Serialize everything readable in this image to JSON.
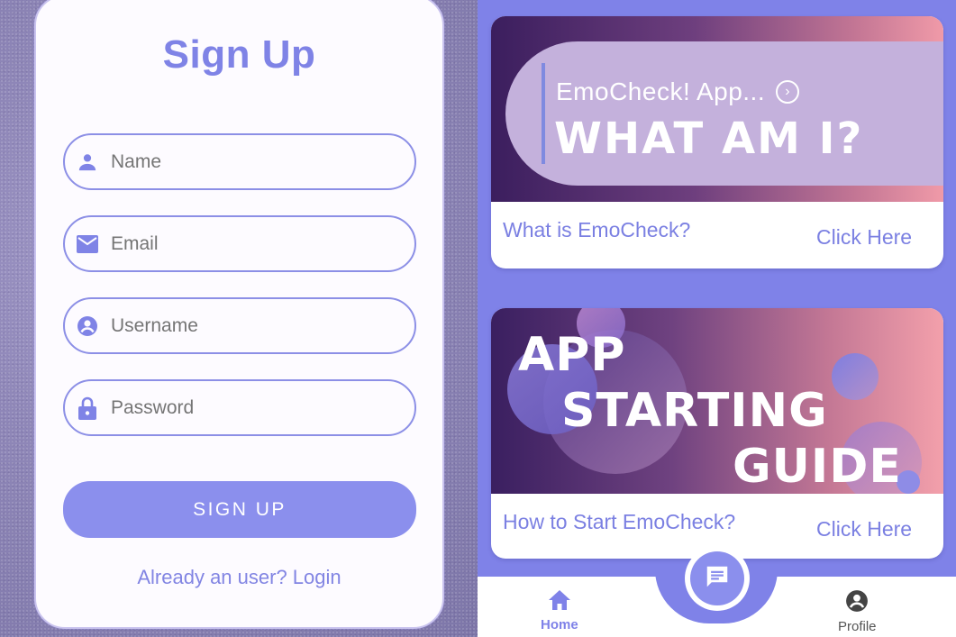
{
  "signup": {
    "title": "Sign Up",
    "fields": [
      {
        "placeholder": "Name",
        "icon": "person-icon"
      },
      {
        "placeholder": "Email",
        "icon": "mail-icon"
      },
      {
        "placeholder": "Username",
        "icon": "account-circle-icon"
      },
      {
        "placeholder": "Password",
        "icon": "lock-icon"
      }
    ],
    "button_label": "SIGN UP",
    "login_link": "Already an user? Login"
  },
  "home": {
    "cards": [
      {
        "banner_subtitle": "EmoCheck! App...",
        "banner_title": "WHAT AM I?",
        "caption": "What is EmoCheck?",
        "action": "Click Here"
      },
      {
        "banner_lines": [
          "APP",
          "STARTING",
          "GUIDE"
        ],
        "caption": "How to Start EmoCheck?",
        "action": "Click Here"
      }
    ],
    "nav": {
      "home_label": "Home",
      "profile_label": "Profile",
      "center_icon": "chat-icon"
    }
  },
  "colors": {
    "accent": "#7f82e8",
    "button": "#8b8fed",
    "card_pill": "#c4b1dc",
    "gradient_dark": "#3b1e5e",
    "gradient_pink": "#f09aa8"
  }
}
